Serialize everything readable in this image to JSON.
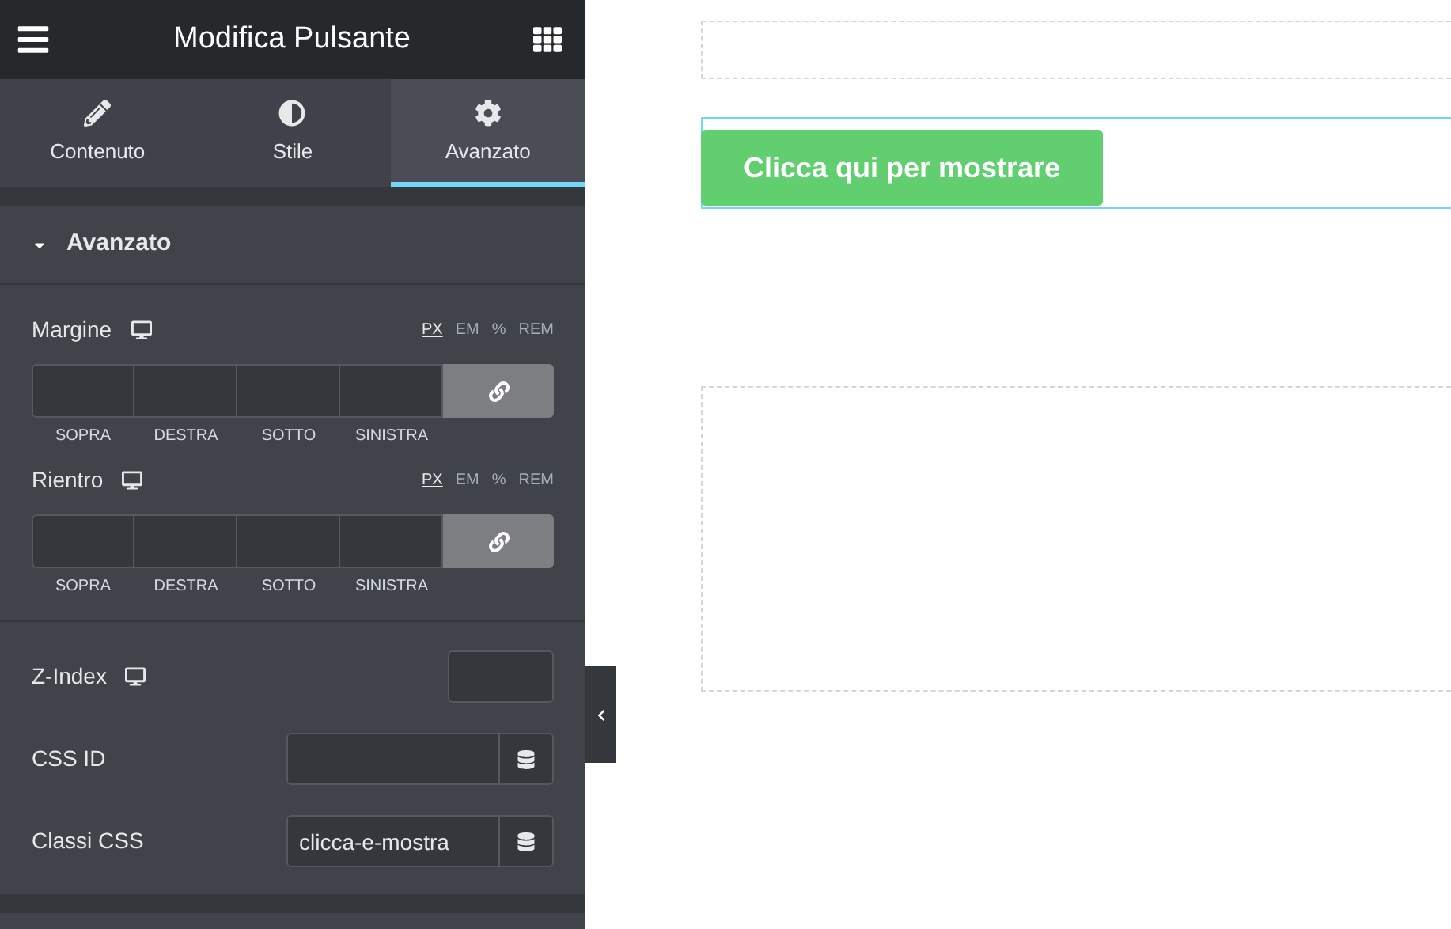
{
  "header": {
    "title": "Modifica Pulsante"
  },
  "tabs": [
    {
      "label": "Contenuto",
      "selected": false
    },
    {
      "label": "Stile",
      "selected": false
    },
    {
      "label": "Avanzato",
      "selected": true
    }
  ],
  "section": {
    "title": "Avanzato",
    "expanded": true
  },
  "dimension_controls": [
    {
      "label": "Margine",
      "units": [
        {
          "label": "PX",
          "selected": true
        },
        {
          "label": "EM",
          "selected": false
        },
        {
          "label": "%",
          "selected": false
        },
        {
          "label": "REM",
          "selected": false
        }
      ],
      "sides": [
        "SOPRA",
        "DESTRA",
        "SOTTO",
        "SINISTRA"
      ]
    },
    {
      "label": "Rientro",
      "units": [
        {
          "label": "PX",
          "selected": true
        },
        {
          "label": "EM",
          "selected": false
        },
        {
          "label": "%",
          "selected": false
        },
        {
          "label": "REM",
          "selected": false
        }
      ],
      "sides": [
        "SOPRA",
        "DESTRA",
        "SOTTO",
        "SINISTRA"
      ]
    }
  ],
  "fields": [
    {
      "kind": "number",
      "label": "Z-Index",
      "responsive": true
    },
    {
      "kind": "dynamic",
      "label": "CSS ID",
      "responsive": false
    },
    {
      "kind": "dynamic",
      "label": "Classi CSS",
      "responsive": false,
      "value": "clicca-e-mostra"
    }
  ],
  "canvas": {
    "button": {
      "label": "Clicca qui per mostrare",
      "selected": true
    }
  }
}
